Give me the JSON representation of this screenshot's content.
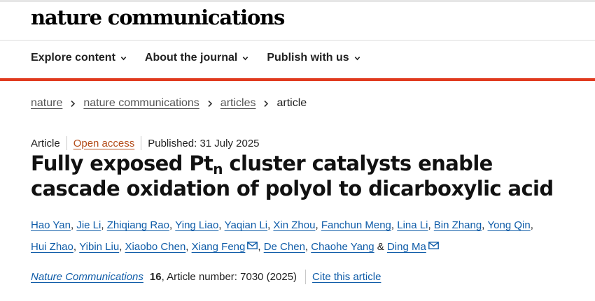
{
  "header": {
    "brand": "nature communications",
    "nav": [
      {
        "label": "Explore content"
      },
      {
        "label": "About the journal"
      },
      {
        "label": "Publish with us"
      }
    ]
  },
  "breadcrumb": {
    "items": [
      "nature",
      "nature communications",
      "articles"
    ],
    "current": "article"
  },
  "article": {
    "type": "Article",
    "access": "Open access",
    "published": "Published: 31 July 2025",
    "title_part1": "Fully exposed Pt",
    "title_subscript": "n",
    "title_part2": " cluster catalysts enable cascade oxidation of polyol to dicarboxylic acid",
    "authors": [
      {
        "name": "Hao Yan",
        "sep": ", ",
        "mail": false
      },
      {
        "name": "Jie Li",
        "sep": ", ",
        "mail": false
      },
      {
        "name": "Zhiqiang Rao",
        "sep": ", ",
        "mail": false
      },
      {
        "name": "Ying Liao",
        "sep": ", ",
        "mail": false
      },
      {
        "name": "Yaqian Li",
        "sep": ", ",
        "mail": false
      },
      {
        "name": "Xin Zhou",
        "sep": ", ",
        "mail": false
      },
      {
        "name": "Fanchun Meng",
        "sep": ", ",
        "mail": false
      },
      {
        "name": "Lina Li",
        "sep": ", ",
        "mail": false
      },
      {
        "name": "Bin Zhang",
        "sep": ", ",
        "mail": false
      },
      {
        "name": "Yong Qin",
        "sep": ", ",
        "mail": false
      },
      {
        "name": "Hui Zhao",
        "sep": ", ",
        "mail": false
      },
      {
        "name": "Yibin Liu",
        "sep": ", ",
        "mail": false
      },
      {
        "name": "Xiaobo Chen",
        "sep": ", ",
        "mail": false
      },
      {
        "name": "Xiang Feng",
        "sep": ", ",
        "mail": true
      },
      {
        "name": "De Chen",
        "sep": ", ",
        "mail": false
      },
      {
        "name": "Chaohe Yang",
        "sep": " & ",
        "mail": false
      },
      {
        "name": "Ding Ma",
        "sep": "",
        "mail": true
      }
    ],
    "citation": {
      "journal": "Nature Communications",
      "volume": "16",
      "article_number": ", Article number: 7030 (2025)",
      "cite_label": "Cite this article"
    }
  },
  "colors": {
    "accent_bar": "#e03a1e",
    "link": "#0f5ca8",
    "open_access": "#b44d1a"
  },
  "icons": {
    "nav_chevron": "chevron-down-icon",
    "breadcrumb_separator": "chevron-right-icon",
    "author_contact": "mail-icon"
  }
}
